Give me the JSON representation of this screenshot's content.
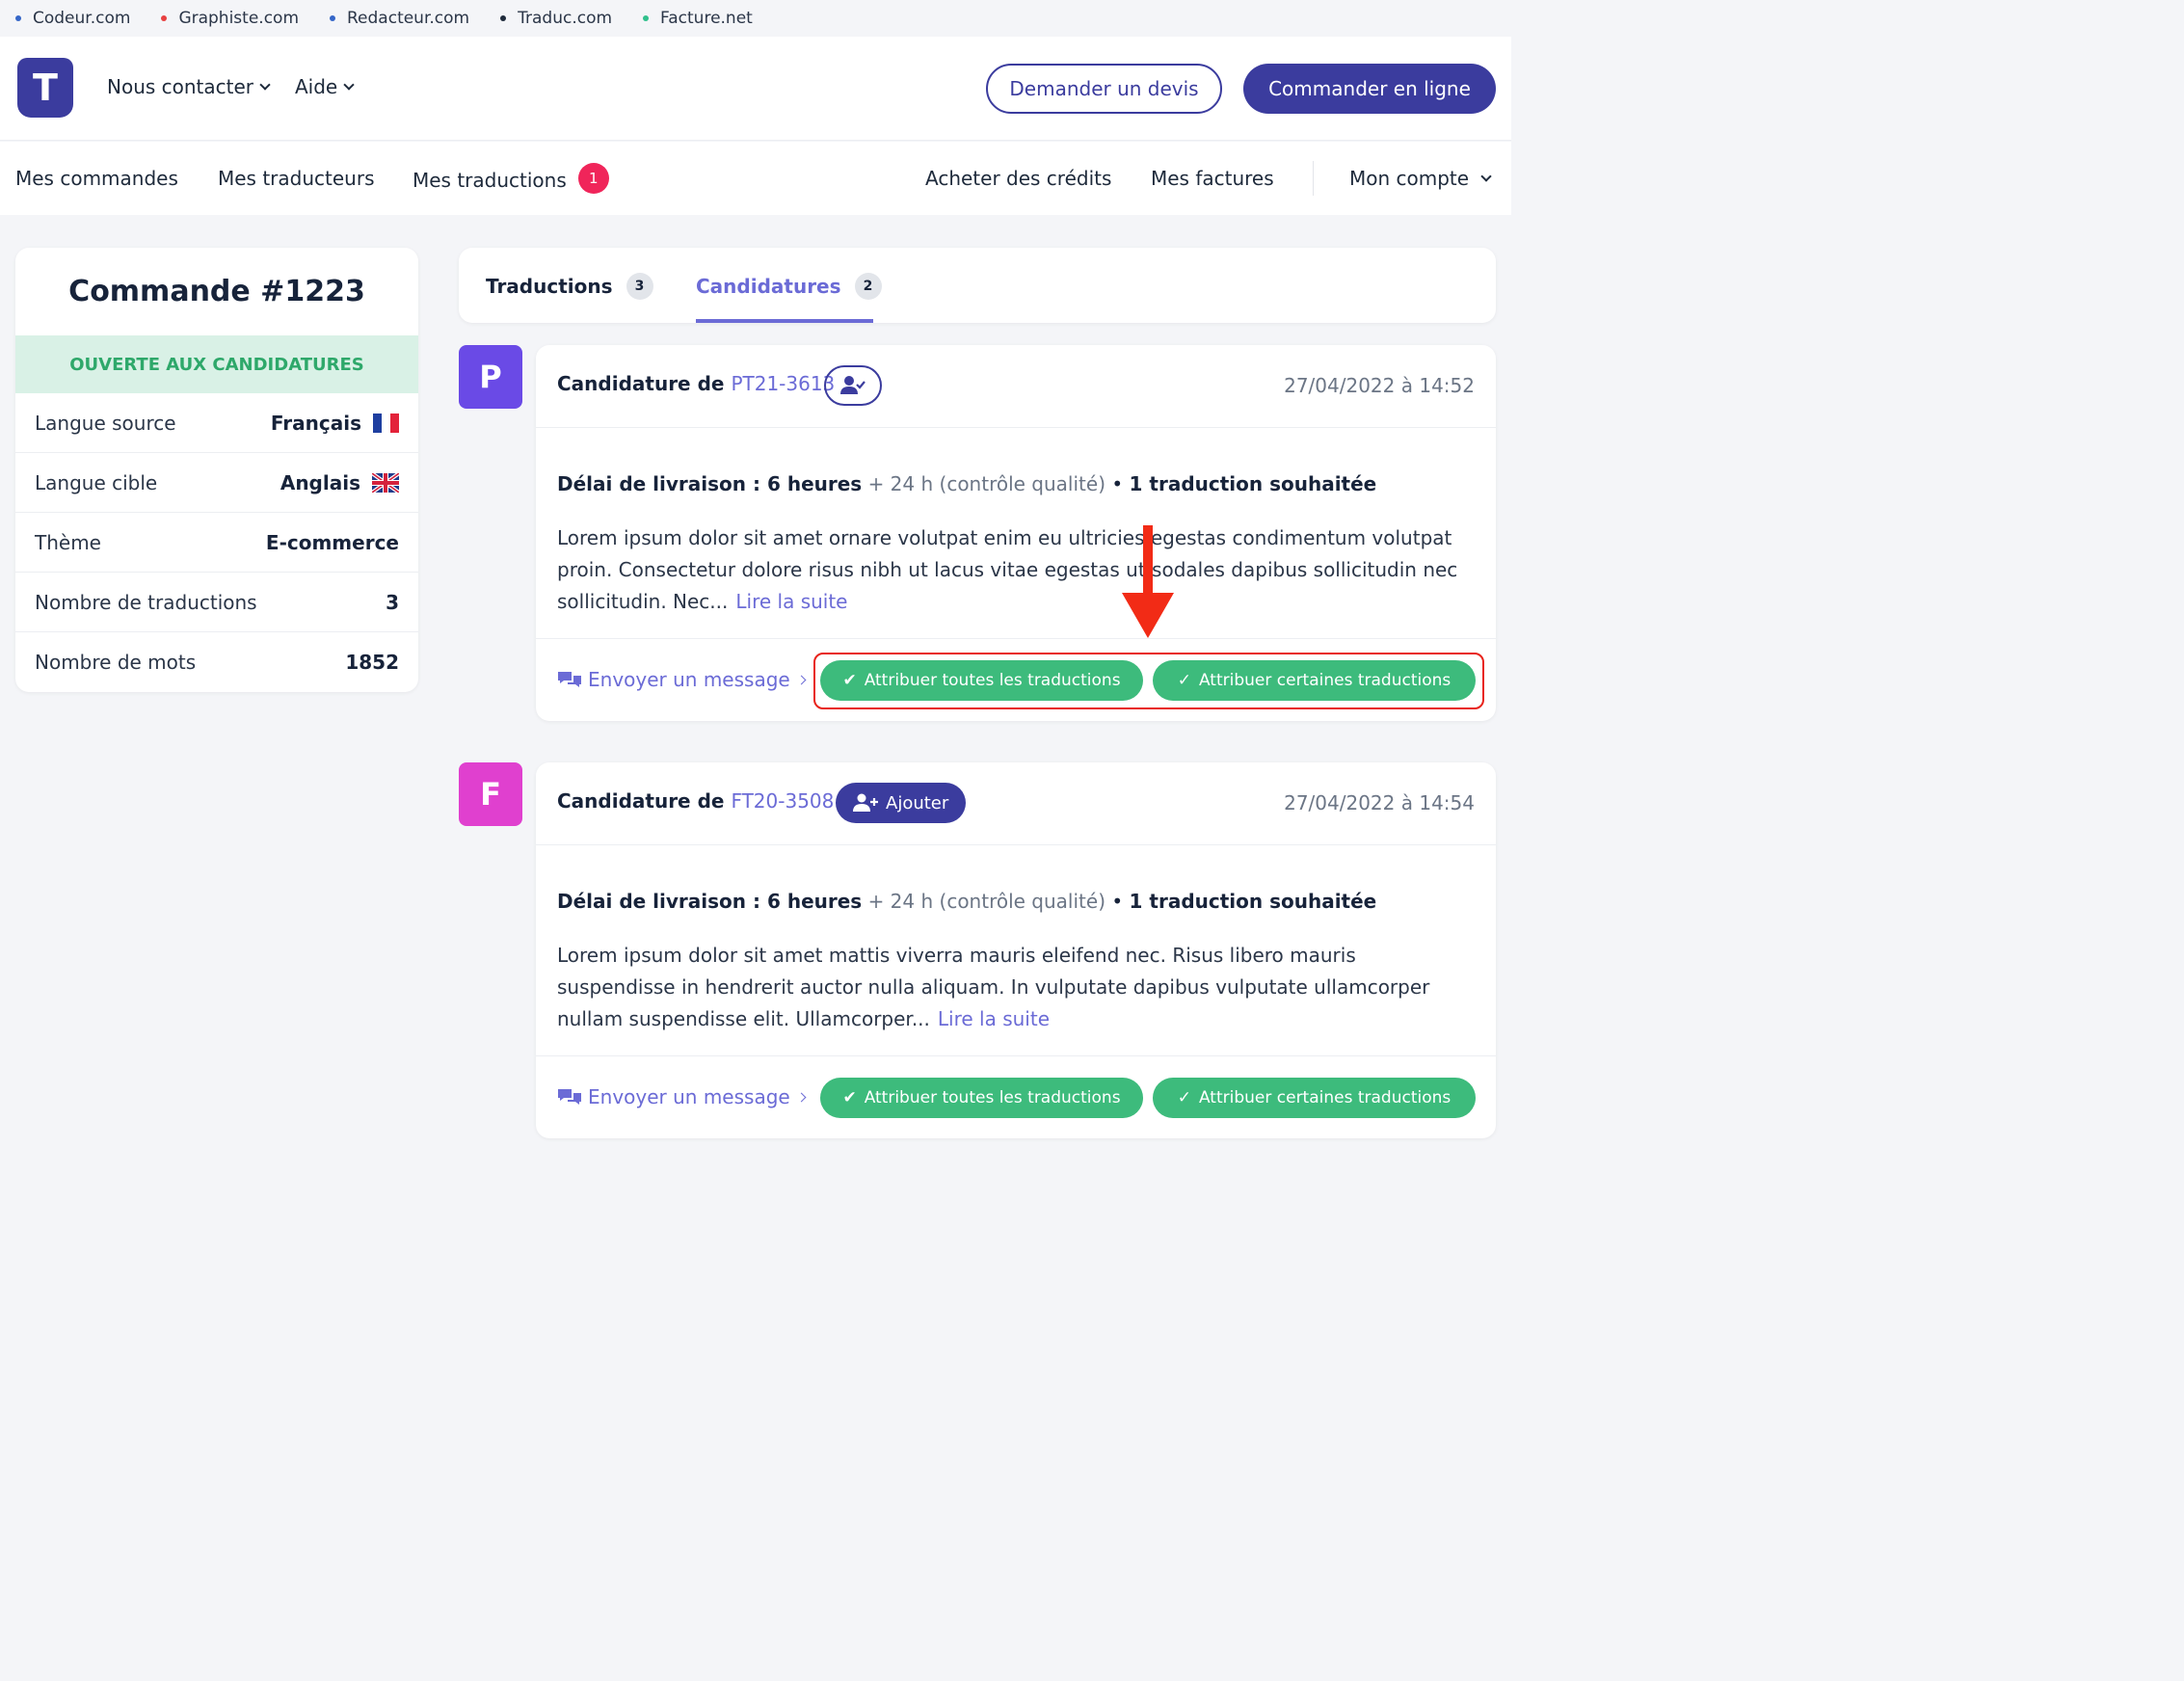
{
  "network": [
    {
      "label": "Codeur.com",
      "color": "#3566c8"
    },
    {
      "label": "Graphiste.com",
      "color": "#e84040"
    },
    {
      "label": "Redacteur.com",
      "color": "#3566c8"
    },
    {
      "label": "Traduc.com",
      "color": "#1e2a3b"
    },
    {
      "label": "Facture.net",
      "color": "#2fc08c"
    }
  ],
  "header": {
    "logo_letter": "T",
    "nav": [
      "Nous contacter",
      "Aide"
    ],
    "quote_button": "Demander un devis",
    "order_button": "Commander en ligne"
  },
  "subnav": {
    "orders": "Mes commandes",
    "translators": "Mes traducteurs",
    "translations": "Mes traductions",
    "translations_badge": "1",
    "buy_credits": "Acheter des crédits",
    "invoices": "Mes factures",
    "account": "Mon compte"
  },
  "order": {
    "title": "Commande #1223",
    "status": "OUVERTE AUX CANDIDATURES",
    "rows": [
      {
        "label": "Langue source",
        "value": "Français"
      },
      {
        "label": "Langue cible",
        "value": "Anglais"
      },
      {
        "label": "Thème",
        "value": "E-commerce"
      },
      {
        "label": "Nombre de traductions",
        "value": "3"
      },
      {
        "label": "Nombre de mots",
        "value": "1852"
      }
    ]
  },
  "tabs": [
    {
      "label": "Traductions",
      "count": "3"
    },
    {
      "label": "Candidatures",
      "count": "2"
    }
  ],
  "candidatures": [
    {
      "avatar": "P",
      "avatar_color": "#6a4ae6",
      "title_prefix": "Candidature de",
      "id": "PT21-3613",
      "date": "27/04/2022 à 14:52",
      "delay_label": "Délai de livraison : 6 heures",
      "delay_extra": "+ 24 h (contrôle qualité)",
      "wanted": "1 traduction souhaitée",
      "text": "Lorem ipsum dolor sit amet ornare volutpat enim eu ultricies egestas condimentum volutpat proin. Consectetur dolore risus nibh ut lacus vitae egestas ut sodales dapibus sollicitudin nec sollicitudin. Nec...",
      "read_more": "Lire la suite",
      "message": "Envoyer un message",
      "assign_all": "Attribuer toutes les traductions",
      "assign_some": "Attribuer certaines traductions"
    },
    {
      "avatar": "F",
      "avatar_color": "#e040cf",
      "title_prefix": "Candidature de",
      "id": "FT20-3508",
      "add_label": "Ajouter",
      "date": "27/04/2022 à 14:54",
      "delay_label": "Délai de livraison : 6 heures",
      "delay_extra": "+ 24 h (contrôle qualité)",
      "wanted": "1 traduction souhaitée",
      "text": "Lorem ipsum dolor sit amet mattis viverra mauris eleifend nec. Risus libero mauris suspendisse in hendrerit auctor nulla aliquam. In vulputate dapibus vulputate ullamcorper nullam suspendisse elit. Ullamcorper...",
      "read_more": "Lire la suite",
      "message": "Envoyer un message",
      "assign_all": "Attribuer toutes les traductions",
      "assign_some": "Attribuer certaines traductions"
    }
  ]
}
